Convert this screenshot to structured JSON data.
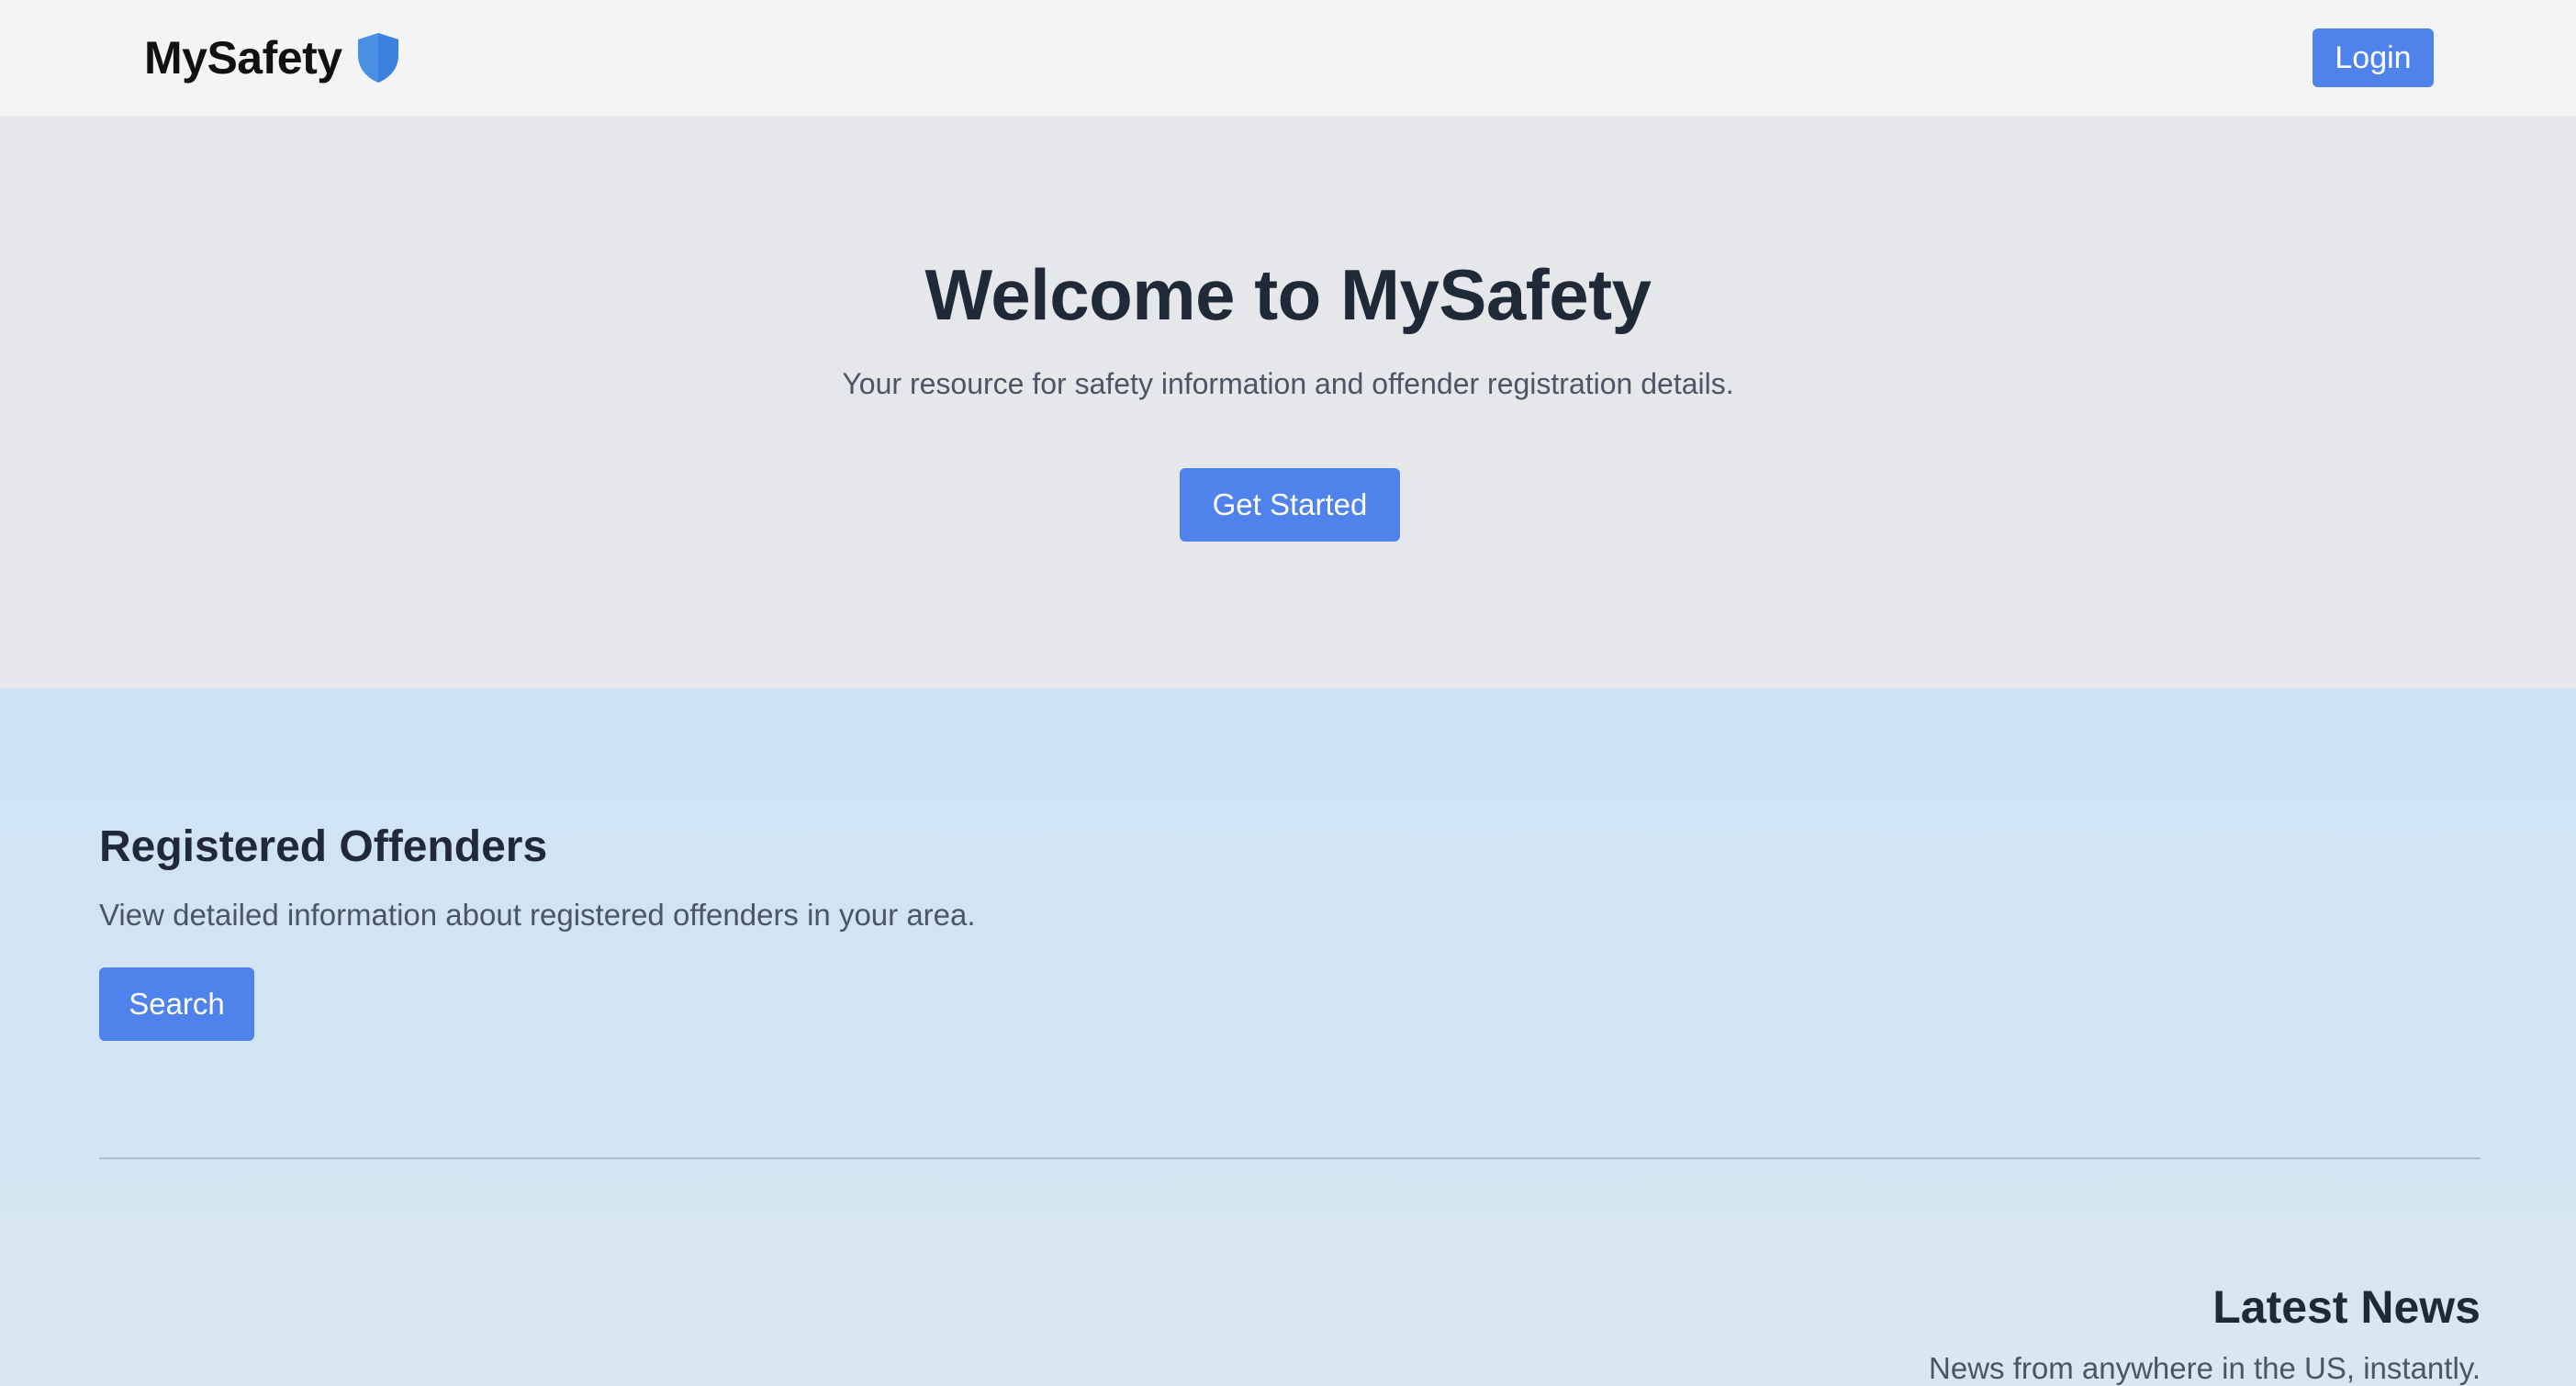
{
  "header": {
    "brand_name": "MySafety",
    "brand_icon": "shield-icon",
    "login_label": "Login"
  },
  "hero": {
    "title": "Welcome to MySafety",
    "subtitle": "Your resource for safety information and offender registration details.",
    "cta_label": "Get Started"
  },
  "offenders": {
    "title": "Registered Offenders",
    "description": "View detailed information about registered offenders in your area.",
    "search_label": "Search"
  },
  "news": {
    "title": "Latest News",
    "description": "News from anywhere in the US, instantly."
  },
  "colors": {
    "accent": "#4f82ea",
    "shield": "#4a90e2",
    "header_bg": "#f3f4f6",
    "hero_bg": "#e5e7eb",
    "content_bg": "#d3e6f4"
  }
}
